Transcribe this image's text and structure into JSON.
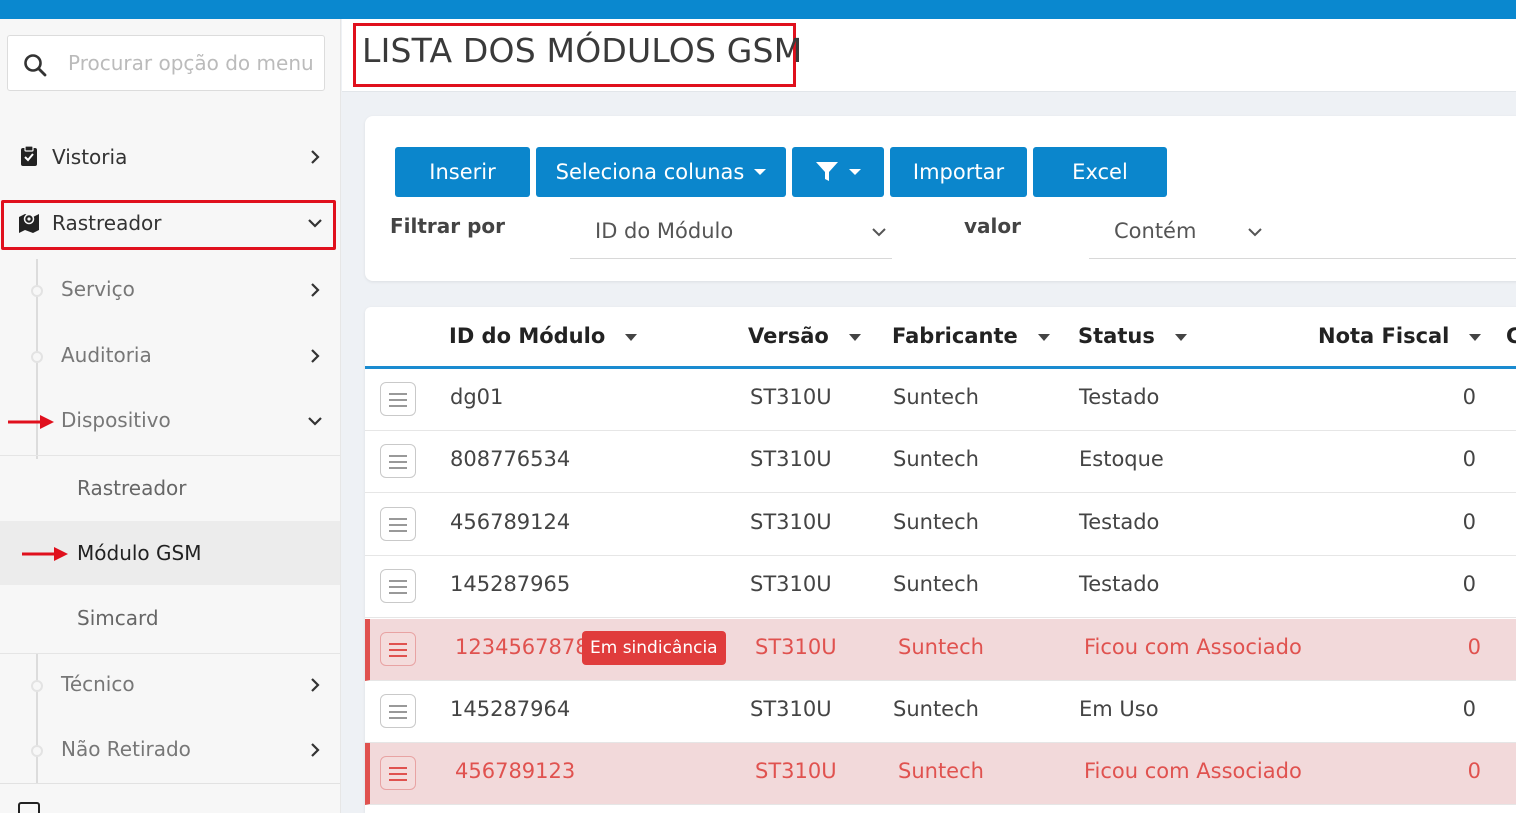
{
  "sidebar": {
    "search_placeholder": "Procurar opção do menu",
    "items": [
      {
        "label": "Vistoria"
      },
      {
        "label": "Rastreador"
      }
    ],
    "subitems": [
      {
        "label": "Serviço"
      },
      {
        "label": "Auditoria"
      },
      {
        "label": "Dispositivo"
      }
    ],
    "leaves": [
      {
        "label": "Rastreador"
      },
      {
        "label": "Módulo GSM"
      },
      {
        "label": "Simcard"
      }
    ],
    "subitems2": [
      {
        "label": "Técnico"
      },
      {
        "label": "Não Retirado"
      }
    ]
  },
  "page": {
    "title": "LISTA DOS MÓDULOS GSM"
  },
  "toolbar": {
    "insert": "Inserir",
    "columns": "Seleciona colunas",
    "import": "Importar",
    "excel": "Excel"
  },
  "filter": {
    "filter_by_label": "Filtrar por",
    "filter_by_value": "ID do Módulo",
    "value_label": "valor",
    "value_value": "Contém"
  },
  "table": {
    "columns": [
      "ID do Módulo",
      "Versão",
      "Fabricante",
      "Status",
      "Nota Fiscal",
      "C"
    ],
    "rows": [
      {
        "id": "dg01",
        "versao": "ST310U",
        "fabricante": "Suntech",
        "status": "Testado",
        "nota": "0"
      },
      {
        "id": "808776534",
        "versao": "ST310U",
        "fabricante": "Suntech",
        "status": "Estoque",
        "nota": "0"
      },
      {
        "id": "456789124",
        "versao": "ST310U",
        "fabricante": "Suntech",
        "status": "Testado",
        "nota": "0"
      },
      {
        "id": "145287965",
        "versao": "ST310U",
        "fabricante": "Suntech",
        "status": "Testado",
        "nota": "0"
      },
      {
        "id": "1234567878",
        "badge": "Em sindicância",
        "versao": "ST310U",
        "fabricante": "Suntech",
        "status": "Ficou com Associado",
        "nota": "0"
      },
      {
        "id": "145287964",
        "versao": "ST310U",
        "fabricante": "Suntech",
        "status": "Em Uso",
        "nota": "0"
      },
      {
        "id": "456789123",
        "versao": "ST310U",
        "fabricante": "Suntech",
        "status": "Ficou com Associado",
        "nota": "0"
      }
    ]
  },
  "colors": {
    "brand": "#0b86cc",
    "highlight": "#e0101d",
    "alert_text": "#e0524f",
    "alert_bg": "#f2d9da"
  }
}
